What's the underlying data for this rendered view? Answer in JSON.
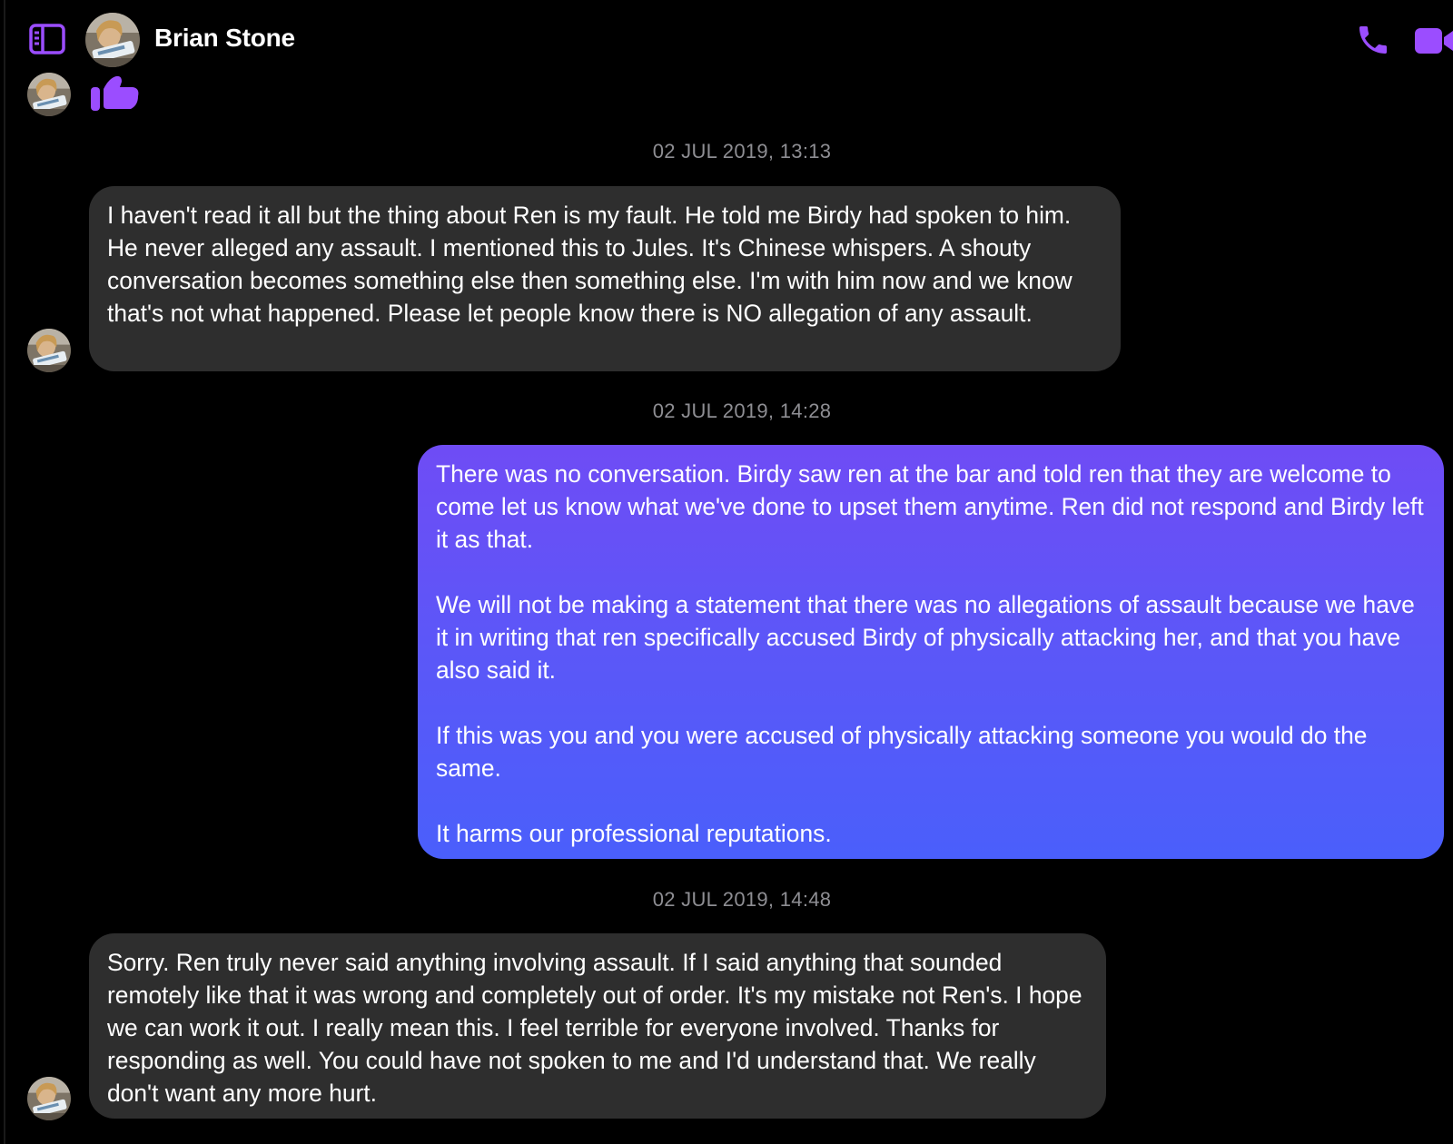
{
  "header": {
    "contact_name": "Brian Stone"
  },
  "colors": {
    "accent": "#9b4dff",
    "incoming_bubble": "#2e2e2e",
    "outgoing_bubble_top": "#6f4cf5",
    "outgoing_bubble_bottom": "#4a5ffb",
    "timestamp": "#8e8e93"
  },
  "icons": {
    "sidebar_toggle": "sidebar-icon",
    "call": "phone-icon",
    "video": "video-camera-icon",
    "reaction": "thumbs-up-icon"
  },
  "messages": [
    {
      "timestamp": "02 JUL 2019, 13:13",
      "direction": "incoming",
      "text": "I haven't read it all but the thing about Ren is my fault. He told me Birdy had spoken to him. He never alleged any assault. I mentioned this to Jules. It's Chinese whispers. A shouty conversation becomes something else then something else. I'm with him now and we know that's not what happened. Please let people know there is NO allegation of any assault."
    },
    {
      "timestamp": "02 JUL 2019, 14:28",
      "direction": "outgoing",
      "text": "There was no conversation. Birdy saw ren at the bar and told ren that they are welcome to come let us know what we've done to upset them anytime. Ren did not respond and Birdy left it as that.\n\nWe will not be making a statement that there was no allegations of assault because we have it in writing that ren specifically accused Birdy of physically attacking her, and that you have also said it.\n\nIf this was you and you were accused of physically attacking someone you would do the same.\n\nIt harms our professional reputations."
    },
    {
      "timestamp": "02 JUL 2019, 14:48",
      "direction": "incoming",
      "text": "Sorry. Ren truly never said anything involving assault. If I said anything that sounded remotely like that it was wrong and completely out of order. It's my mistake not Ren's. I hope we can work it out. I really mean this. I feel terrible for everyone involved. Thanks for responding as well. You could have not spoken to me and I'd understand that. We really don't want any more hurt."
    }
  ]
}
